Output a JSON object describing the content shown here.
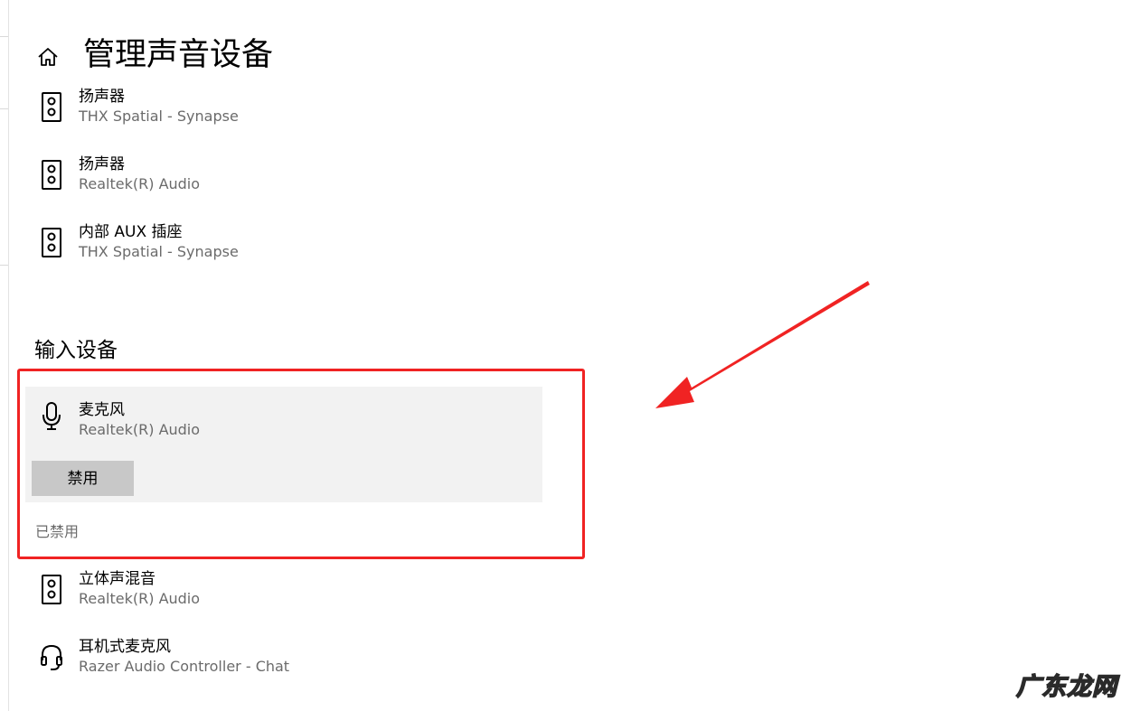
{
  "page": {
    "title": "管理声音设备",
    "home_icon": "home-icon"
  },
  "output_devices": [
    {
      "name": "扬声器",
      "sub": "THX Spatial - Synapse",
      "icon": "speaker-icon"
    },
    {
      "name": "扬声器",
      "sub": "Realtek(R) Audio",
      "icon": "speaker-icon"
    },
    {
      "name": "内部 AUX 插座",
      "sub": "THX Spatial - Synapse",
      "icon": "speaker-icon"
    }
  ],
  "input_section": {
    "heading": "输入设备",
    "selected_device": {
      "name": "麦克风",
      "sub": "Realtek(R) Audio",
      "icon": "microphone-icon",
      "button_label": "禁用"
    },
    "disabled_label": "已禁用",
    "devices": [
      {
        "name": "立体声混音",
        "sub": "Realtek(R) Audio",
        "icon": "speaker-icon"
      },
      {
        "name": "耳机式麦克风",
        "sub": "Razer Audio Controller - Chat",
        "icon": "headset-icon"
      }
    ]
  },
  "annotations": {
    "highlight_color": "#f02323",
    "arrow_color": "#f02323"
  },
  "watermark": {
    "text": "广东龙网"
  }
}
